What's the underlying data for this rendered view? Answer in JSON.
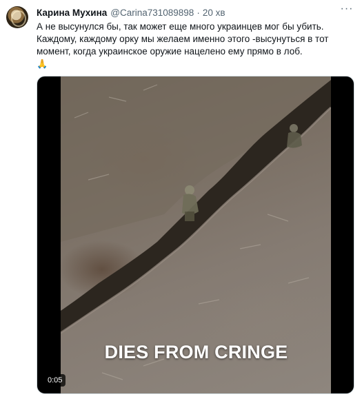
{
  "author": {
    "name": "Карина Мухина",
    "handle": "@Carina731089898",
    "separator": "·",
    "time": "20 хв"
  },
  "tweet": {
    "line1": "А не высунулся бы, так может еще много украинцев мог бы убить.",
    "line2": "Каждому, каждому орку мы желаем именно этого -высунуться в тот момент, когда украинское оружие нацелено ему прямо в лоб.",
    "emoji": "🙏"
  },
  "media": {
    "caption": "DIES FROM CRINGE",
    "duration": "0:05"
  },
  "icons": {
    "more": "more-options-icon",
    "avatar": "avatar-image"
  }
}
